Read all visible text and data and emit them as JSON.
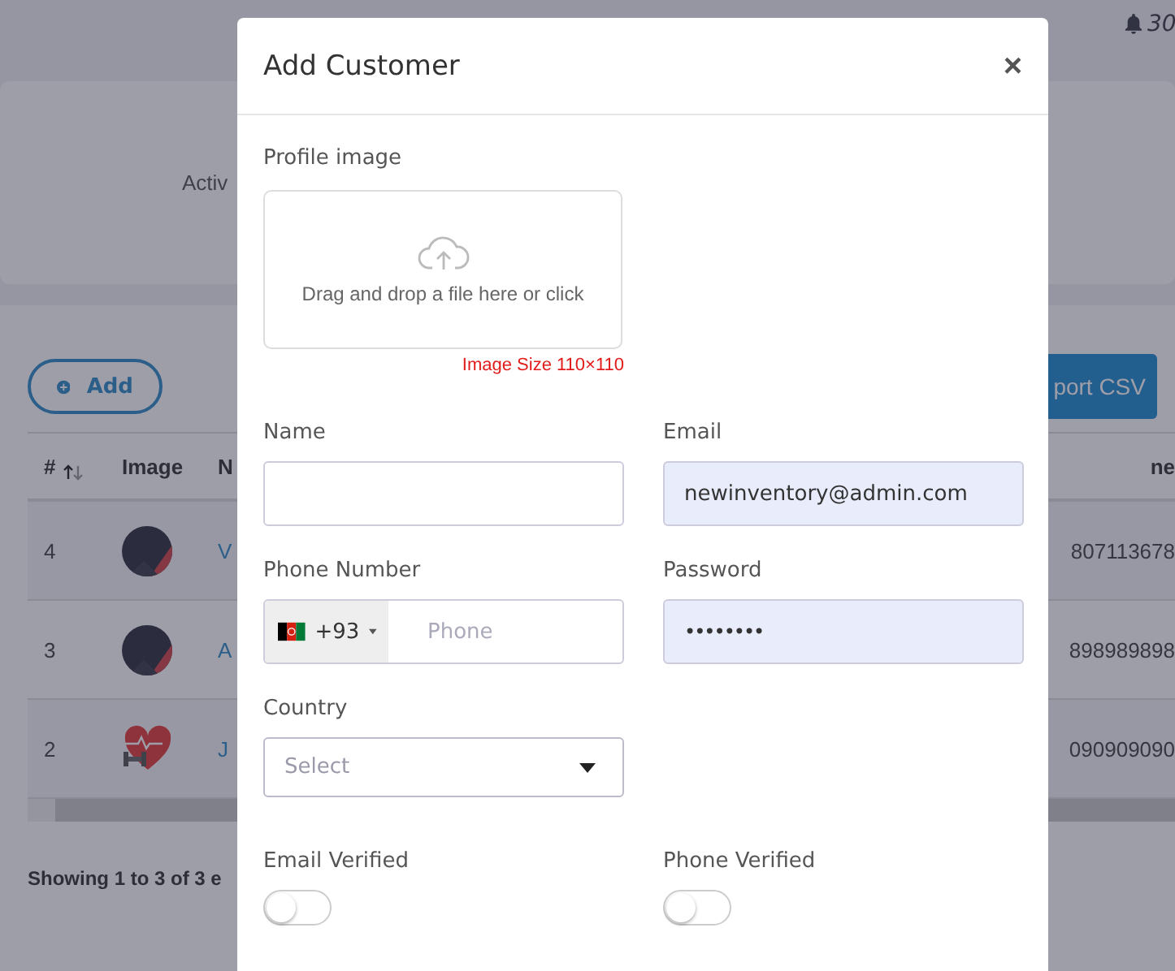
{
  "background": {
    "notification_count": "30",
    "stats_label": "Activ",
    "add_button": "Add",
    "export_button": "port CSV",
    "table": {
      "columns": [
        "#",
        "Image",
        "N",
        "ne"
      ],
      "rows": [
        {
          "number": "4",
          "kind": "avatar",
          "name": "V",
          "phone": "807113678"
        },
        {
          "number": "3",
          "kind": "avatar",
          "name": "A",
          "phone": "898989898"
        },
        {
          "number": "2",
          "kind": "heart",
          "name": "J",
          "phone": "090909090"
        }
      ]
    },
    "footer": "Showing 1 to 3 of 3 e"
  },
  "modal": {
    "title": "Add Customer",
    "close": "×",
    "profile_image": {
      "label": "Profile image",
      "dropzone_text": "Drag and drop a file here or click",
      "size_hint": "Image Size 110×110"
    },
    "fields": [
      {
        "kind": "text",
        "label": "Name",
        "autofilled": false
      },
      {
        "kind": "text",
        "label": "Email",
        "value": "newinventory@admin.com",
        "autofilled": true
      },
      {
        "kind": "phone",
        "label": "Phone Number",
        "dial_code": "+93",
        "placeholder": "Phone",
        "autofilled": false
      },
      {
        "kind": "password",
        "label": "Password",
        "value": "••••••••",
        "autofilled": true
      },
      {
        "kind": "select",
        "label": "Country",
        "placeholder": "Select",
        "autofilled": false
      }
    ],
    "toggles": [
      {
        "label": "Email Verified",
        "on": false
      },
      {
        "label": "Phone Verified",
        "on": false
      }
    ]
  }
}
